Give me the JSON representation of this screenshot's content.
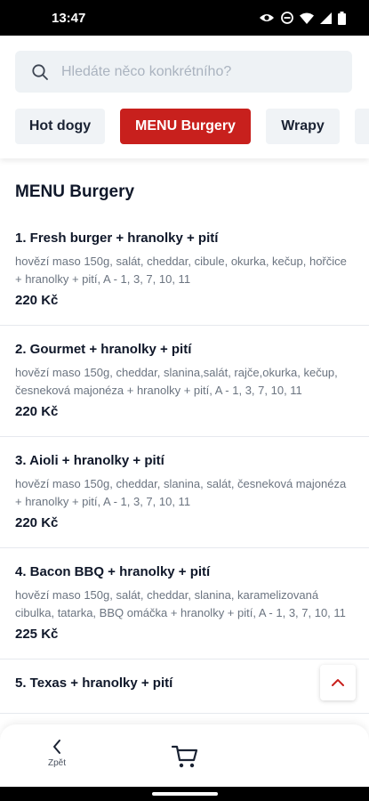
{
  "status_bar": {
    "time": "13:47"
  },
  "search": {
    "placeholder": "Hledáte něco konkrétního?"
  },
  "tabs": [
    {
      "label": "Hot dogy"
    },
    {
      "label": "MENU Burgery",
      "active": true
    },
    {
      "label": "Wrapy"
    }
  ],
  "section": {
    "title": "MENU Burgery"
  },
  "items": [
    {
      "name": "1. Fresh burger + hranolky + pití",
      "description": "hovězí maso 150g, salát, cheddar, cibule, okurka, kečup, hořčice + hranolky + pití, A - 1, 3, 7, 10, 11",
      "price": "220 Kč"
    },
    {
      "name": "2. Gourmet + hranolky + pití",
      "description": "hovězí maso 150g, cheddar, slanina,salát, rajče,okurka, kečup, česneková majonéza + hranolky + pití, A - 1, 3, 7, 10, 11",
      "price": "220 Kč"
    },
    {
      "name": "3. Aioli + hranolky + pití",
      "description": "hovězí maso 150g, cheddar, slanina, salát, česneková majonéza + hranolky + pití, A - 1, 3, 7, 10, 11",
      "price": "220 Kč"
    },
    {
      "name": "4. Bacon BBQ + hranolky + pití",
      "description": "hovězí maso 150g, salát, cheddar, slanina, karamelizovaná cibulka, tatarka, BBQ omáčka + hranolky + pití, A - 1, 3, 7, 10, 11",
      "price": "225 Kč"
    },
    {
      "name": "5. Texas + hranolky + pití",
      "description": "",
      "price": ""
    }
  ],
  "bottom_nav": {
    "back_label": "Zpět"
  },
  "icons": {
    "search": "search-icon",
    "back": "chevron-left-icon",
    "cart": "cart-icon",
    "scroll_top": "chevron-up-icon"
  },
  "colors": {
    "accent": "#c8201d",
    "search_bg": "#eef2f5",
    "tab_bg": "#f0f3f6"
  }
}
